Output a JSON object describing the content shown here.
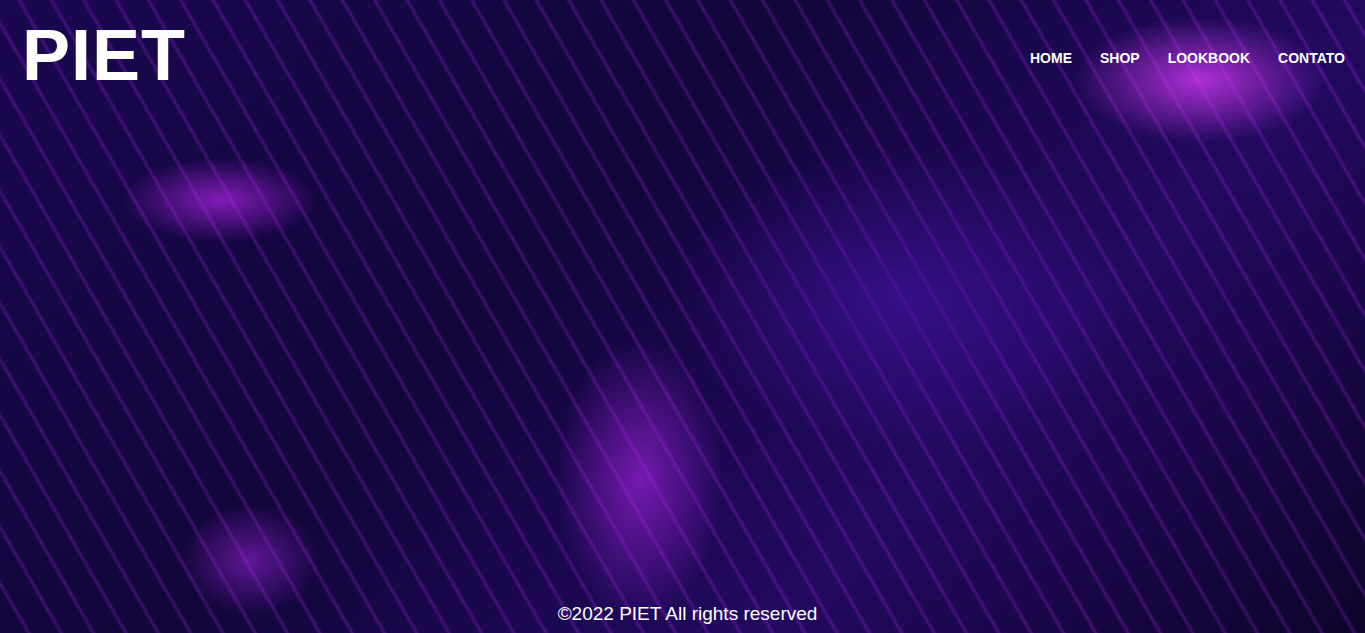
{
  "header": {
    "logo": "PIET"
  },
  "nav": {
    "items": [
      {
        "label": "HOME"
      },
      {
        "label": "SHOP"
      },
      {
        "label": "LOOKBOOK"
      },
      {
        "label": "CONTATO"
      }
    ]
  },
  "footer": {
    "text": "©2022 PIET All rights reserved"
  }
}
